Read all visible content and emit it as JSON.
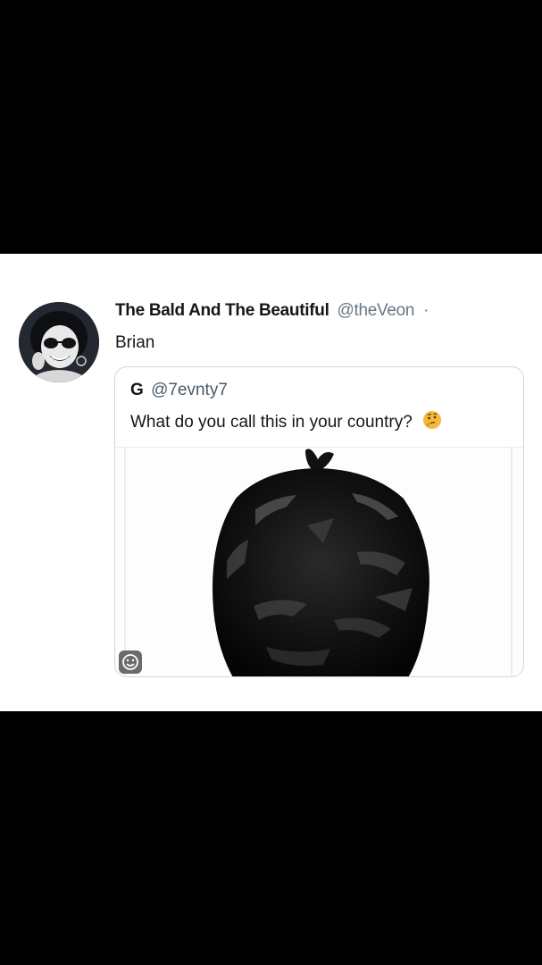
{
  "tweet": {
    "author_name": "The Bald And The Beautiful",
    "author_handle": "@theVeon",
    "separator": "·",
    "text": "Brian",
    "avatar_icon": "profile-photo"
  },
  "quoted_tweet": {
    "author_name": "G",
    "author_handle": "@7evnty7",
    "text": "What do you call this in your country?",
    "emoji_icon": "thinking-face-icon",
    "media_subject": "black-trash-bag-image"
  },
  "colors": {
    "letterbox": "#000000",
    "card_bg": "#ffffff",
    "handle": "#657786",
    "border": "#ccd6dd"
  }
}
